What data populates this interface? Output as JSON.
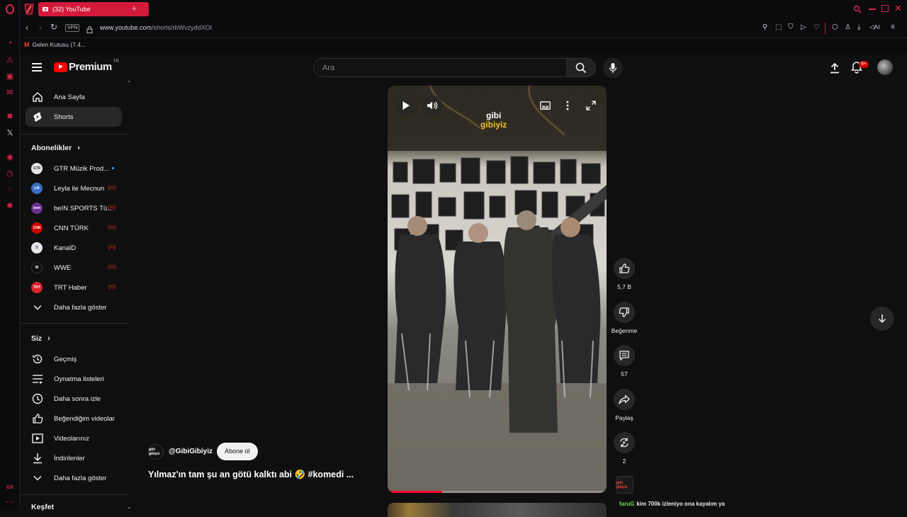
{
  "browser": {
    "tab_title": "(32) YouTube",
    "url_domain": "www.youtube.com",
    "url_path": "/shorts/rbWvzyddXOI",
    "vpn_label": "VPN",
    "bookmark_label": "Gelen Kutusu (7.4...",
    "ai_label": "AI"
  },
  "header": {
    "logo_text": "Premium",
    "region": "TR",
    "search_placeholder": "Ara",
    "notification_count": "9+"
  },
  "sidebar": {
    "main": [
      {
        "label": "Ana Sayfa",
        "icon": "home-icon"
      },
      {
        "label": "Shorts",
        "icon": "shorts-icon"
      }
    ],
    "subscriptions_title": "Abonelikler",
    "subscriptions": [
      {
        "label": "GTR Müzik Prod...",
        "avatar": "GTR",
        "color": "#dddddd",
        "status": "new"
      },
      {
        "label": "Leyla ile Mecnun",
        "avatar": "LM",
        "color": "#3a6fc4",
        "status": "live"
      },
      {
        "label": "beIN SPORTS Tü...",
        "avatar": "bein",
        "color": "#6b2e8e",
        "status": "live"
      },
      {
        "label": "CNN TÜRK",
        "avatar": "CNN",
        "color": "#cc0000",
        "status": "live"
      },
      {
        "label": "KanalD",
        "avatar": "D",
        "color": "#e6e6e6",
        "status": "live"
      },
      {
        "label": "WWE",
        "avatar": "W",
        "color": "#111111",
        "status": "live"
      },
      {
        "label": "TRT Haber",
        "avatar": "TRT",
        "color": "#d8262e",
        "status": "live"
      }
    ],
    "show_more_1": "Daha fazla göster",
    "you_title": "Siz",
    "you_items": [
      {
        "label": "Geçmiş",
        "icon": "history-icon"
      },
      {
        "label": "Oynatma listeleri",
        "icon": "playlists-icon"
      },
      {
        "label": "Daha sonra izle",
        "icon": "clock-icon"
      },
      {
        "label": "Beğendiğim videolar",
        "icon": "like-icon"
      },
      {
        "label": "Videolarınız",
        "icon": "your-videos-icon"
      },
      {
        "label": "İndirilenler",
        "icon": "download-icon"
      }
    ],
    "show_more_2": "Daha fazla göster",
    "explore_title": "Keşfet"
  },
  "short": {
    "watermark_line1": "gibi",
    "watermark_line2": "gibiyiz",
    "channel_handle": "@GibiGibiyiz",
    "channel_avatar": "gibi gibiyiz",
    "subscribe_label": "Abone ol",
    "title": "Yılmaz'ın tam şu an götü kalktı abi 🤣 #komedi ...",
    "progress": 0.25
  },
  "actions": {
    "like_count": "5,7 B",
    "dislike_label": "Beğenme",
    "comment_count": "57",
    "share_label": "Paylaş",
    "remix_count": "2"
  },
  "comment_preview": {
    "user": "faruG",
    "text": "kim 700k izleniyo ona kayalım ya"
  }
}
